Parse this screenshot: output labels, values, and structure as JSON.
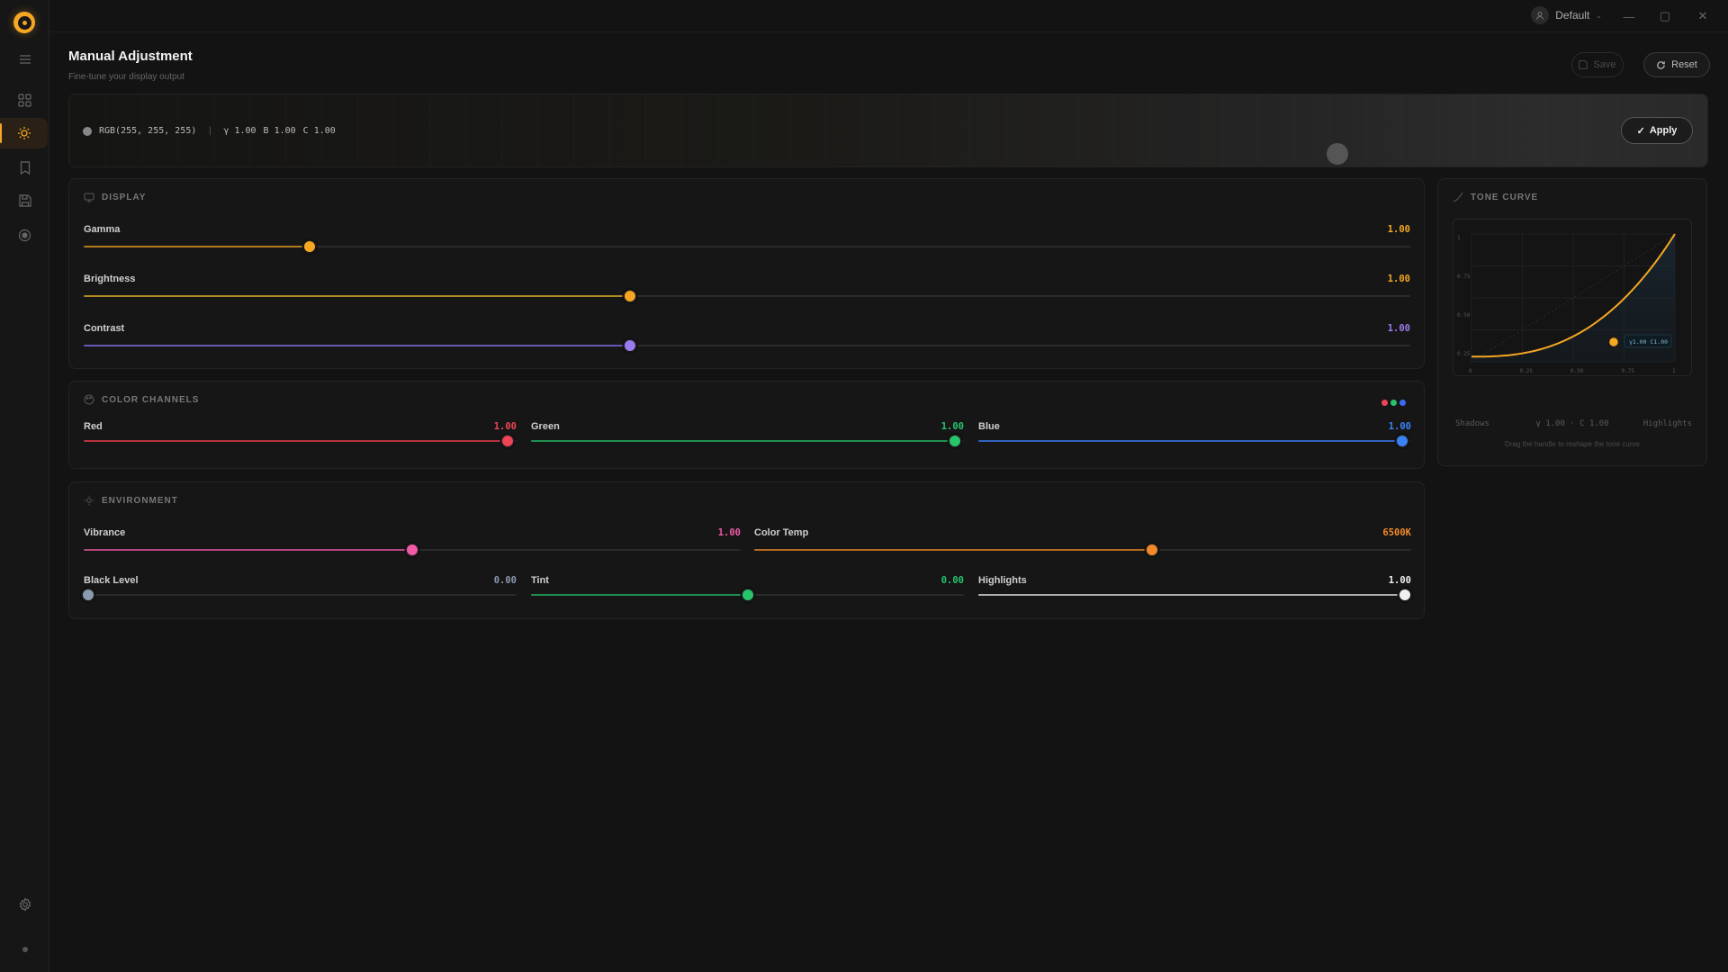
{
  "window": {
    "profile": "Default",
    "minimize": "—",
    "maximize": "▢",
    "close": "✕"
  },
  "header": {
    "title": "Manual Adjustment",
    "subtitle": "Fine-tune your display output"
  },
  "toolbar": {
    "save_label": "Save",
    "reset_label": "Reset",
    "apply_label": "Apply"
  },
  "preview": {
    "rgb": "RGB(255, 255, 255)",
    "sep": "|",
    "gamma": "γ 1.00",
    "brightness": "B 1.00",
    "contrast": "C 1.00"
  },
  "sidebar": {
    "items": [
      {
        "icon": "menu-icon"
      },
      {
        "icon": "grid-icon"
      },
      {
        "icon": "sun-icon",
        "active": true
      },
      {
        "icon": "bookmark-icon"
      },
      {
        "icon": "save-icon"
      },
      {
        "icon": "target-icon"
      }
    ]
  },
  "display": {
    "title": "DISPLAY",
    "sliders": [
      {
        "label": "Gamma",
        "value": "1.00",
        "level": 0.17,
        "color": "#f5a623",
        "fill": "#b07a1a"
      },
      {
        "label": "Brightness",
        "value": "1.00",
        "level": 0.412,
        "color": "#f5a623",
        "fill": "#b08a22"
      },
      {
        "label": "Contrast",
        "value": "1.00",
        "level": 0.412,
        "color": "#9b7bf0",
        "fill": "#6a58b0"
      }
    ]
  },
  "channels": {
    "title": "COLOR CHANNELS",
    "sliders": [
      {
        "label": "Red",
        "value": "1.00",
        "level": 0.98,
        "color": "#ef4455",
        "fill": "#b8323f"
      },
      {
        "label": "Green",
        "value": "1.00",
        "level": 0.98,
        "color": "#27c46b",
        "fill": "#1f8f50"
      },
      {
        "label": "Blue",
        "value": "1.00",
        "level": 0.98,
        "color": "#3b82f6",
        "fill": "#2f64c0"
      }
    ],
    "dot_colors": [
      "#ef4455",
      "#27c46b",
      "#3b6bf6"
    ]
  },
  "environment": {
    "title": "ENVIRONMENT",
    "sliders": [
      {
        "label": "Vibrance",
        "value": "1.00",
        "level": 0.5,
        "color": "#f25aa8",
        "fill": "#b8467f"
      },
      {
        "label": "Color Temp",
        "value": "6500K",
        "level": 0.605,
        "color": "#f28a2c",
        "fill": "#b86a22"
      },
      {
        "label": "Black Level",
        "value": "0.00",
        "level": 0.01,
        "color": "#8a9bb0",
        "fill": "#5a6576"
      },
      {
        "label": "Tint",
        "value": "0.00",
        "level": 0.5,
        "color": "#27c46b",
        "fill": "#1f8f50"
      },
      {
        "label": "Highlights",
        "value": "1.00",
        "level": 0.985,
        "color": "#f0f0f0",
        "fill": "#b0b0b0"
      }
    ]
  },
  "tone_curve": {
    "title": "TONE CURVE",
    "y_ticks": [
      "1",
      "0.75",
      "0.50",
      "0.25"
    ],
    "x_ticks": [
      "0",
      "0.25",
      "0.50",
      "0.75",
      "1"
    ],
    "handle_label": "γ1.00 C1.00",
    "shadows": "Shadows",
    "readout": "γ 1.00 · C 1.00",
    "highlights": "Highlights",
    "hint": "Drag the handle to reshape the tone curve",
    "curve_color": "#f5a623"
  }
}
